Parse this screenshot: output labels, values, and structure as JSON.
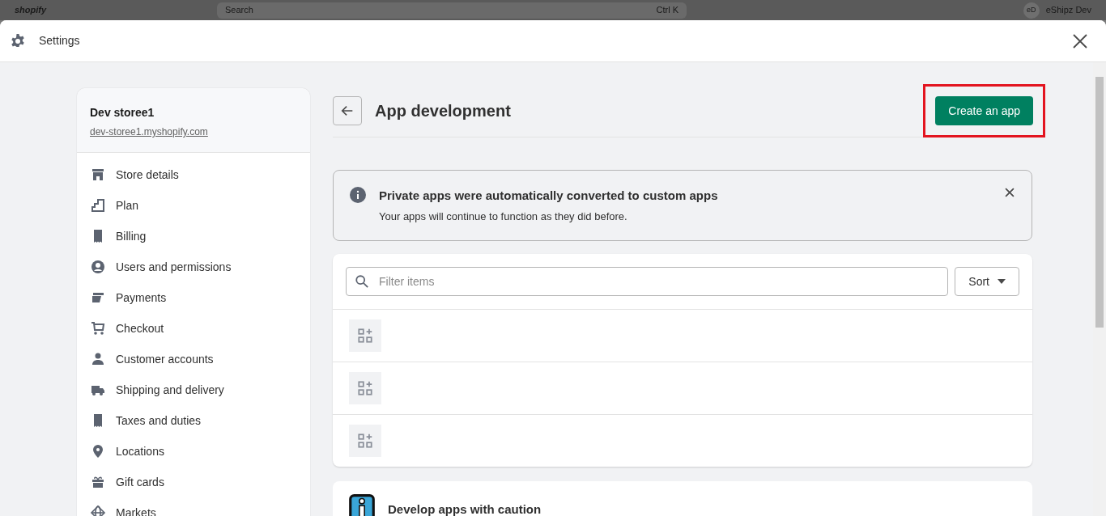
{
  "backdrop": {
    "logo": "shopify",
    "search": {
      "placeholder": "Search",
      "shortcut": "Ctrl K"
    },
    "avatar": "eD",
    "user": "eShipz Dev"
  },
  "window": {
    "title": "Settings"
  },
  "sidebar": {
    "store_name": "Dev storee1",
    "store_url": "dev-storee1.myshopify.com",
    "items": [
      {
        "label": "Store details",
        "kind": "store"
      },
      {
        "label": "Plan",
        "kind": "plan"
      },
      {
        "label": "Billing",
        "kind": "billing"
      },
      {
        "label": "Users and permissions",
        "kind": "user"
      },
      {
        "label": "Payments",
        "kind": "payments"
      },
      {
        "label": "Checkout",
        "kind": "cart"
      },
      {
        "label": "Customer accounts",
        "kind": "person"
      },
      {
        "label": "Shipping and delivery",
        "kind": "truck"
      },
      {
        "label": "Taxes and duties",
        "kind": "tax"
      },
      {
        "label": "Locations",
        "kind": "pin"
      },
      {
        "label": "Gift cards",
        "kind": "gift"
      },
      {
        "label": "Markets",
        "kind": "globe"
      }
    ]
  },
  "page": {
    "title": "App development",
    "primary_action": "Create an app",
    "highlighted": true
  },
  "banner": {
    "title": "Private apps were automatically converted to custom apps",
    "body": "Your apps will continue to function as they did before."
  },
  "app_list": {
    "filter": {
      "placeholder": "Filter items"
    },
    "sort": "Sort",
    "rows": [
      {
        "kind": "app"
      },
      {
        "kind": "app"
      },
      {
        "kind": "app"
      }
    ]
  },
  "caution_card": {
    "title": "Develop apps with caution"
  }
}
